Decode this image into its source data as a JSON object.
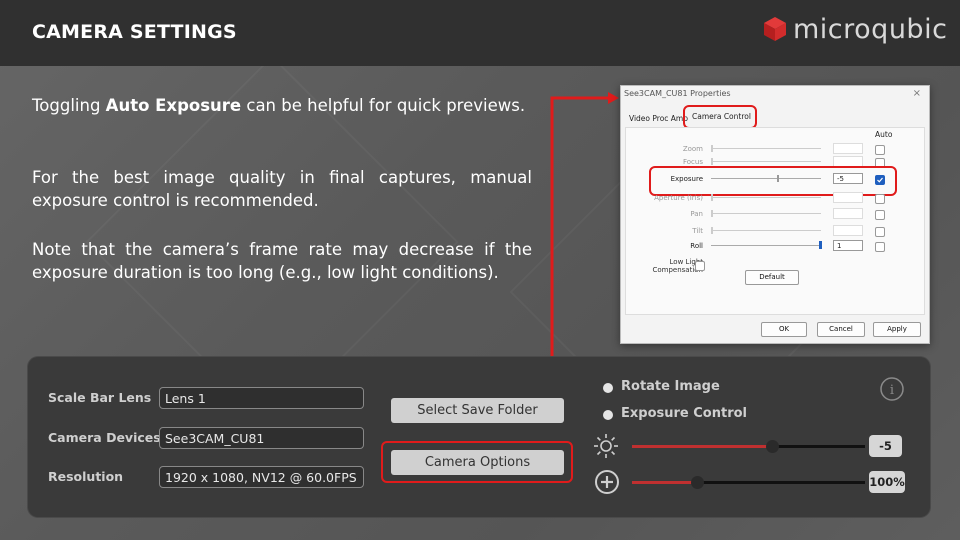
{
  "header": {
    "title": "CAMERA SETTINGS",
    "logo_text": "microqubic"
  },
  "body_text": {
    "p1_pre": "Toggling ",
    "p1_bold": "Auto Exposure",
    "p1_post": " can be helpful for quick previews.",
    "p2": "For the best image quality in final captures, manual exposure control is recommended.",
    "p3": "Note that the camera’s frame rate may decrease if the exposure duration is too long (e.g., low light conditions)."
  },
  "dialog": {
    "title": "See3CAM_CU81 Properties",
    "close": "×",
    "tabs": [
      "Video Proc Amp",
      "Camera Control"
    ],
    "auto_header": "Auto",
    "rows": [
      {
        "label": "Zoom",
        "value": "",
        "auto": false,
        "active": false
      },
      {
        "label": "Focus",
        "value": "",
        "auto": false,
        "active": false
      },
      {
        "label": "Exposure",
        "value": "-5",
        "auto": true,
        "active": true
      },
      {
        "label": "Aperture (Iris)",
        "value": "",
        "auto": false,
        "active": false
      },
      {
        "label": "Pan",
        "value": "",
        "auto": false,
        "active": false
      },
      {
        "label": "Tilt",
        "value": "",
        "auto": false,
        "active": false
      },
      {
        "label": "Roll",
        "value": "1",
        "auto": false,
        "active": true
      }
    ],
    "low_light_label": "Low Light Compensation",
    "default_btn": "Default",
    "ok_btn": "OK",
    "cancel_btn": "Cancel",
    "apply_btn": "Apply"
  },
  "panel": {
    "scale_bar_label": "Scale Bar Lens",
    "scale_bar_value": "Lens 1",
    "camera_devices_label": "Camera Devices",
    "camera_devices_value": "See3CAM_CU81",
    "resolution_label": "Resolution",
    "resolution_value": "1920 x 1080, NV12 @ 60.0FPS",
    "select_save_folder": "Select Save Folder",
    "camera_options": "Camera Options",
    "rotate_image": "Rotate Image",
    "exposure_control": "Exposure Control",
    "exposure_value": "-5",
    "zoom_value": "100%",
    "info_icon": "i"
  },
  "colors": {
    "accent_red": "#e01b1b",
    "header_bg": "#303030",
    "panel_bg": "#3a3a3a"
  }
}
